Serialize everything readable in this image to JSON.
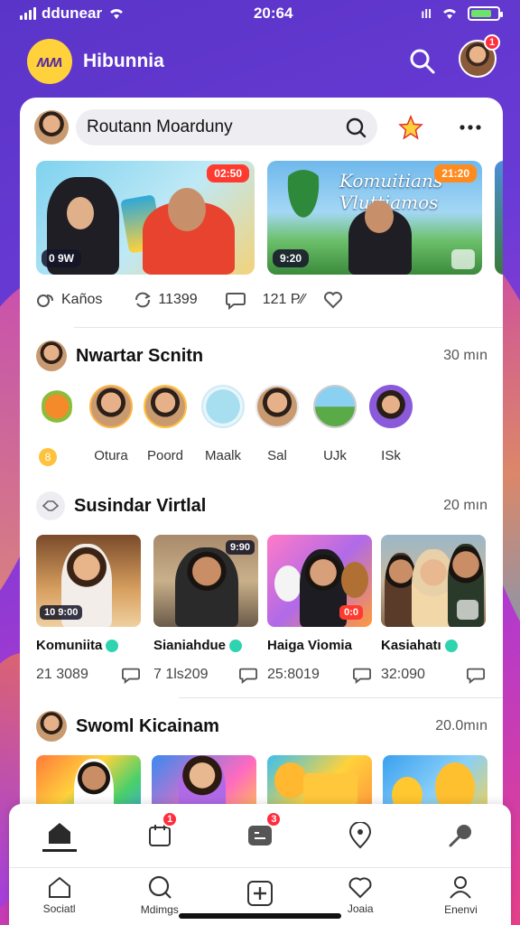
{
  "status_bar": {
    "carrier": "ddunear",
    "time": "20:64",
    "signal_right": "ıll"
  },
  "app": {
    "title": "Hibunnia",
    "logo_text": "ʍʍ",
    "notification_count": "1"
  },
  "search": {
    "value": "Routann Moarduny"
  },
  "featured": {
    "items": [
      {
        "tag": "02:50",
        "bottom_tag": "0 9W",
        "caption": ""
      },
      {
        "tag": "21:20",
        "bottom_tag": "9:20",
        "caption": "Komuitians Vluttiamos"
      }
    ]
  },
  "stats": {
    "label1": "Kaños",
    "count1": "11399",
    "count2": "121 P⁄⁄"
  },
  "sections": [
    {
      "title": "Nwartar Scnitn",
      "time": "30 mın"
    },
    {
      "title": "Susindar Virtlal",
      "time": "20 mın"
    },
    {
      "title": "Swoml Kicainam",
      "time": "20.0mın"
    }
  ],
  "stories": {
    "items": [
      {
        "label": "8"
      },
      {
        "label": "Otura"
      },
      {
        "label": "Poord"
      },
      {
        "label": "Maalk"
      },
      {
        "label": "Sal"
      },
      {
        "label": "UJk"
      },
      {
        "label": "ISk"
      }
    ]
  },
  "videos": [
    {
      "name": "Komuniita",
      "count": "21 3089",
      "tag": "10 9:00"
    },
    {
      "name": "Sianiahdue",
      "count": "7 1ls209",
      "tag": "9:90"
    },
    {
      "name": "Haiga Viomia",
      "count": "25:8019",
      "tag": "0:0"
    },
    {
      "name": "Kasiahatı",
      "count": "32:090",
      "tag": ""
    }
  ],
  "tabs_top": {
    "badge2": "1",
    "badge3": "3"
  },
  "tabs_bottom": [
    {
      "label": "Sociatl"
    },
    {
      "label": "Mdimgs"
    },
    {
      "label": ""
    },
    {
      "label": "Joaia"
    },
    {
      "label": "Enenvi"
    }
  ],
  "colors": {
    "accent": "#6a3bd6",
    "badge": "#ff2d3d",
    "logo": "#ffd23c"
  }
}
